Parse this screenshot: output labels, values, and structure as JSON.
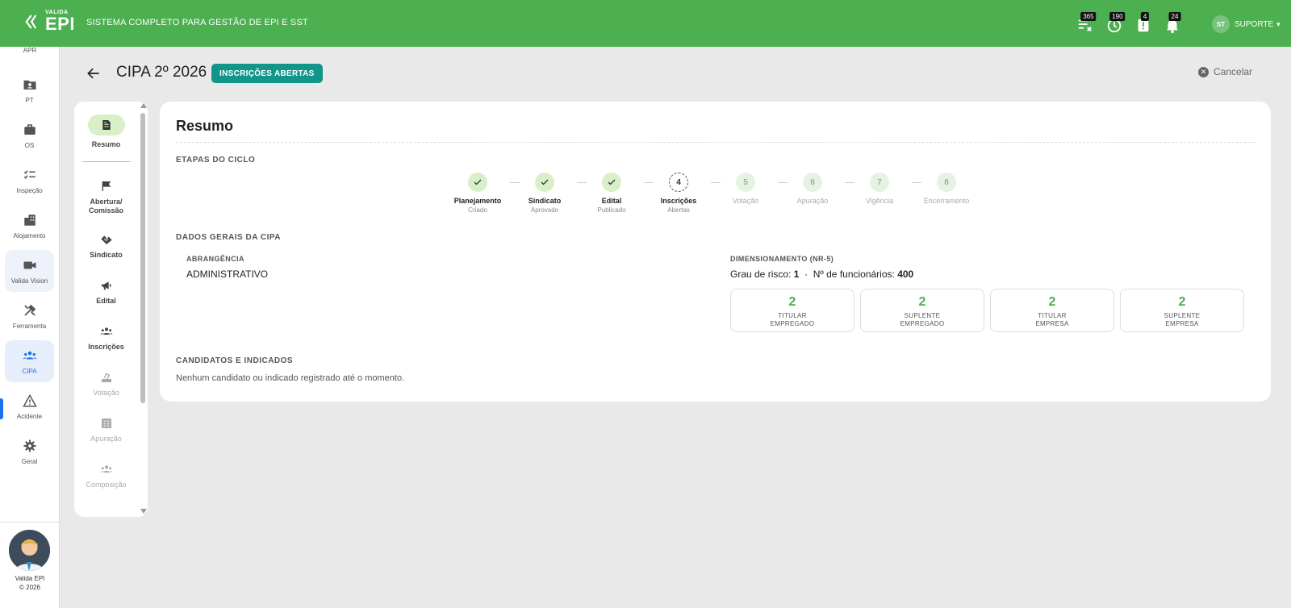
{
  "topbar": {
    "logo_small": "VALIDA",
    "logo_big": "EPI",
    "tagline": "SISTEMA COMPLETO PARA GESTÃO DE EPI E SST",
    "badges": [
      "365",
      "190",
      "4",
      "24"
    ],
    "user_initials": "ST",
    "user_name": "SUPORTE",
    "accent_color": "#4caf50"
  },
  "leftnav": {
    "top_partial": "APR",
    "items": [
      {
        "label": "PT",
        "icon": "folder-user-icon"
      },
      {
        "label": "OS",
        "icon": "briefcase-icon"
      },
      {
        "label": "Inspeção",
        "icon": "checklist-icon"
      },
      {
        "label": "Alojamento",
        "icon": "building-icon"
      },
      {
        "label": "Valida Vision",
        "icon": "video-camera-icon"
      },
      {
        "label": "Ferramenta",
        "icon": "tools-icon"
      },
      {
        "label": "CIPA",
        "icon": "group-icon"
      },
      {
        "label": "Acidente",
        "icon": "warning-icon"
      },
      {
        "label": "Geral",
        "icon": "gear-icon"
      }
    ],
    "footer_line1": "Valida EPI",
    "footer_line2": "© 2026"
  },
  "header": {
    "title": "CIPA 2º 2026",
    "status": "INSCRIÇÕES ABERTAS",
    "cancel": "Cancelar"
  },
  "steps_panel": [
    {
      "label": "Resumo",
      "icon": "document-icon"
    },
    {
      "label": "Abertura/\nComissão",
      "icon": "flag-icon"
    },
    {
      "label": "Sindicato",
      "icon": "handshake-icon"
    },
    {
      "label": "Edital",
      "icon": "megaphone-icon"
    },
    {
      "label": "Inscrições",
      "icon": "group-icon"
    },
    {
      "label": "Votação",
      "icon": "ballot-icon"
    },
    {
      "label": "Apuração",
      "icon": "tally-icon"
    },
    {
      "label": "Composição",
      "icon": "people-icon"
    }
  ],
  "summary": {
    "title": "Resumo",
    "cycle_label": "ETAPAS DO CICLO",
    "steps": [
      {
        "num": "1",
        "name": "Planejamento",
        "sub": "Criado",
        "state": "done"
      },
      {
        "num": "2",
        "name": "Sindicato",
        "sub": "Aprovado",
        "state": "done"
      },
      {
        "num": "3",
        "name": "Edital",
        "sub": "Publicado",
        "state": "done"
      },
      {
        "num": "4",
        "name": "Inscrições",
        "sub": "Abertas",
        "state": "current"
      },
      {
        "num": "5",
        "name": "Votação",
        "sub": "",
        "state": "todo"
      },
      {
        "num": "6",
        "name": "Apuração",
        "sub": "",
        "state": "todo"
      },
      {
        "num": "7",
        "name": "Vigência",
        "sub": "",
        "state": "todo"
      },
      {
        "num": "8",
        "name": "Encerramento",
        "sub": "",
        "state": "todo"
      }
    ],
    "general_label": "DADOS GERAIS DA CIPA",
    "scope_label": "ABRANGÊNCIA",
    "scope_value": "ADMINISTRATIVO",
    "sizing_label": "DIMENSIONAMENTO (NR-5)",
    "risk_label": "Grau de risco:",
    "risk_value": "1",
    "sep": "·",
    "employees_label": "Nº de funcionários:",
    "employees_value": "400",
    "boxes": [
      {
        "value": "2",
        "line1": "TITULAR",
        "line2": "EMPREGADO"
      },
      {
        "value": "2",
        "line1": "SUPLENTE",
        "line2": "EMPREGADO"
      },
      {
        "value": "2",
        "line1": "TITULAR",
        "line2": "EMPRESA"
      },
      {
        "value": "2",
        "line1": "SUPLENTE",
        "line2": "EMPRESA"
      }
    ],
    "candidates_label": "CANDIDATOS E INDICADOS",
    "candidates_empty": "Nenhum candidato ou indicado registrado até o momento."
  }
}
